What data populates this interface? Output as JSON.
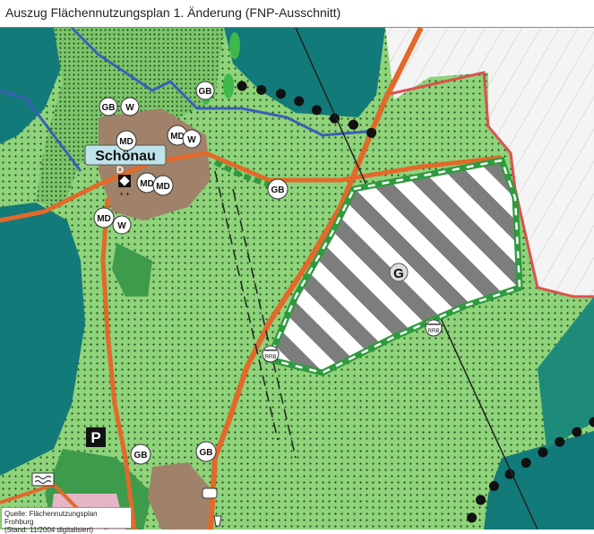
{
  "title": "Auszug Flächennutzungsplan 1. Änderung (FNP-Ausschnitt)",
  "source": {
    "line1": "Quelle: Flächennutzungsplan Frohburg",
    "line2": "(Stand: 11/2004 digitalisiert)"
  },
  "place_name": "Schönau",
  "symbols": {
    "gb": "GB",
    "w": "W",
    "md": "MD",
    "d": "D",
    "g": "G",
    "rrb": "RRB",
    "parking": "P",
    "plus": "+ +"
  },
  "colors": {
    "agri_green": "#7cc66a",
    "forest_dark": "#2e8b57",
    "water_teal": "#137a7a",
    "road_orange": "#e2692a",
    "boundary_red": "#d9534f",
    "hatch_gray": "#7d7d7d",
    "village_brown": "#a0826a"
  }
}
